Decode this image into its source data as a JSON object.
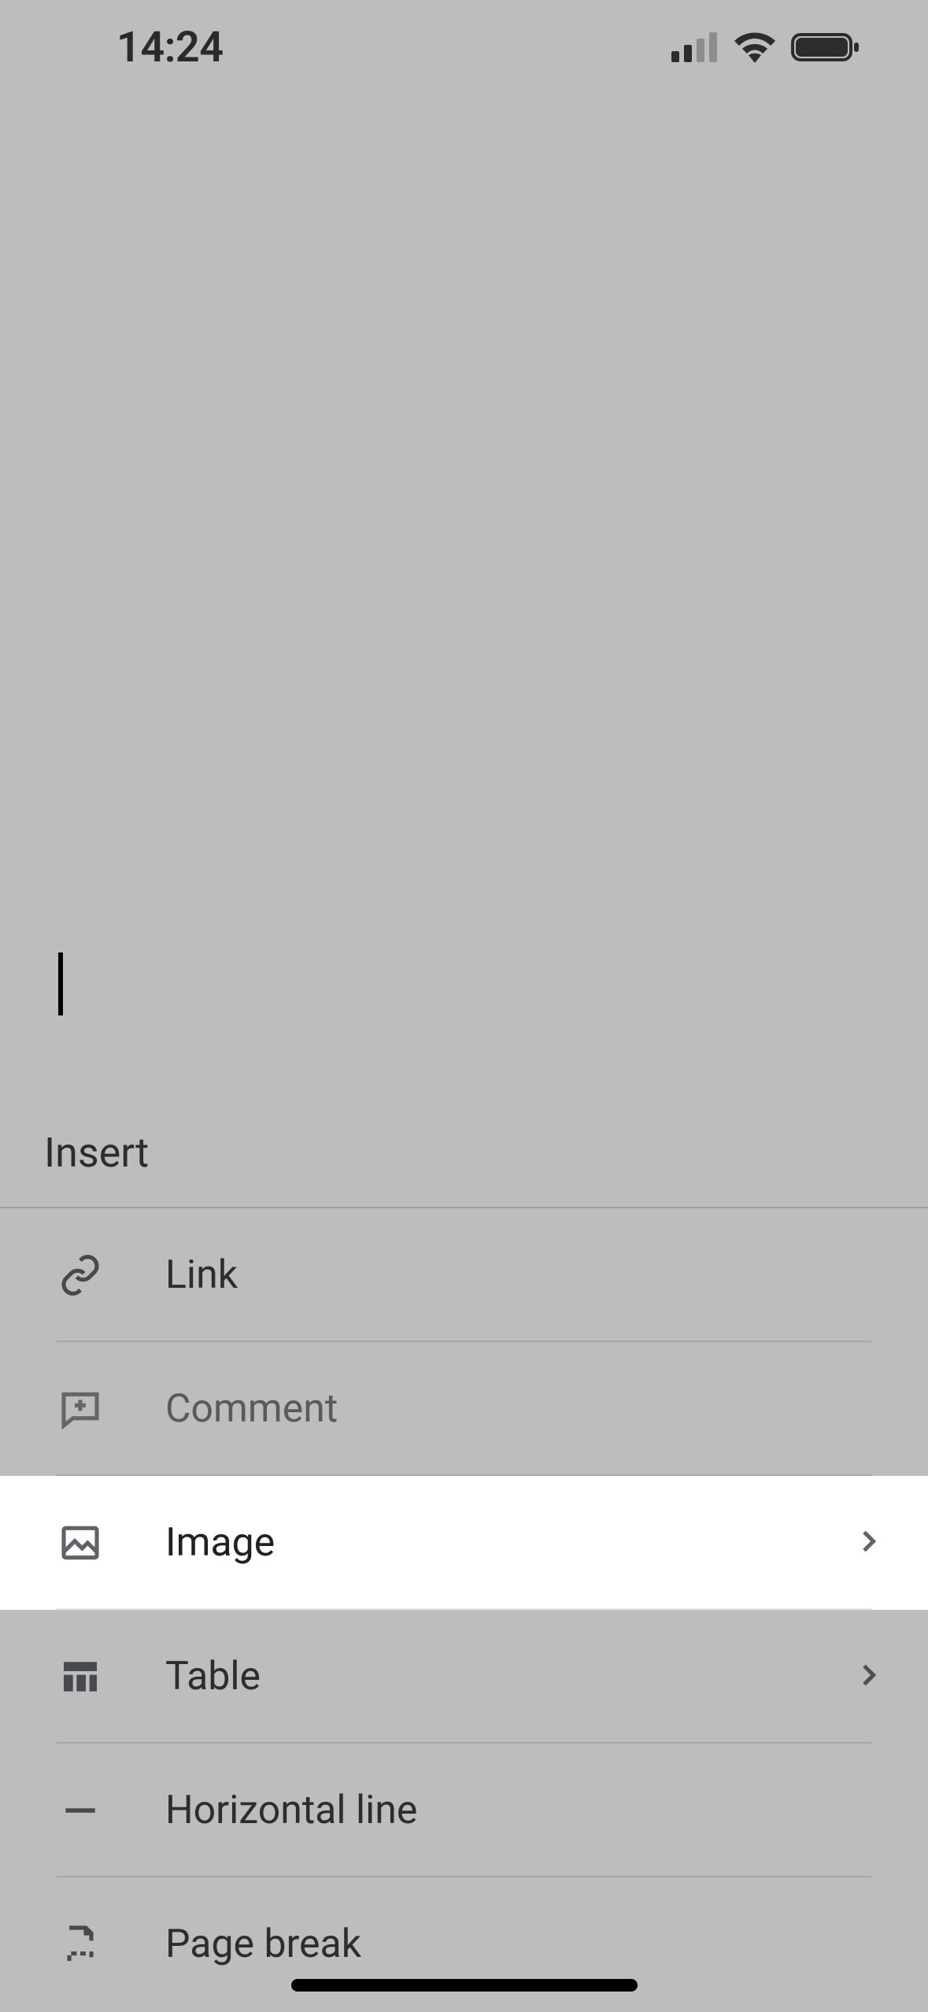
{
  "statusbar": {
    "time": "14:24"
  },
  "insert_panel": {
    "title": "Insert",
    "items": [
      {
        "id": "link",
        "label": "Link",
        "icon": "link-icon",
        "disclosure": false,
        "enabled": true,
        "highlighted": false
      },
      {
        "id": "comment",
        "label": "Comment",
        "icon": "comment-icon",
        "disclosure": false,
        "enabled": false,
        "highlighted": false
      },
      {
        "id": "image",
        "label": "Image",
        "icon": "image-icon",
        "disclosure": true,
        "enabled": true,
        "highlighted": true
      },
      {
        "id": "table",
        "label": "Table",
        "icon": "table-icon",
        "disclosure": true,
        "enabled": true,
        "highlighted": false
      },
      {
        "id": "horizontal_line",
        "label": "Horizontal line",
        "icon": "horizontal-line-icon",
        "disclosure": false,
        "enabled": true,
        "highlighted": false
      },
      {
        "id": "page_break",
        "label": "Page break",
        "icon": "page-break-icon",
        "disclosure": false,
        "enabled": true,
        "highlighted": false
      }
    ]
  }
}
